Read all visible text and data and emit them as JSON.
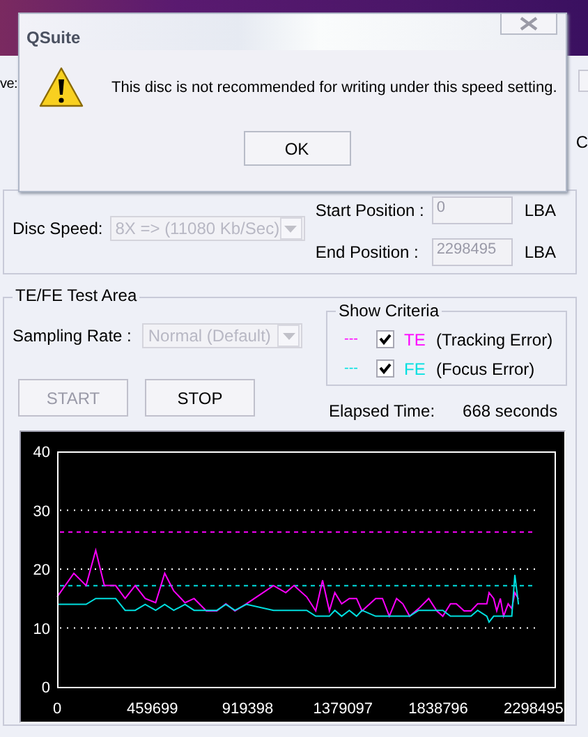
{
  "background_window": {
    "row_label_fragment": "ve:",
    "right_label_fragment": "C"
  },
  "dialog": {
    "title": "QSuite",
    "message": "This disc is not recommended for writing under this speed setting.",
    "buttons": [
      "OK"
    ]
  },
  "settings": {
    "disc_speed": {
      "label": "Disc Speed:",
      "value": "8X => (11080 Kb/Sec)",
      "disabled": true
    },
    "positions": [
      {
        "label": "Start Position :",
        "value": "0",
        "unit": "LBA",
        "disabled": true
      },
      {
        "label": "End Position  :",
        "value": "2298495",
        "unit": "LBA",
        "disabled": true
      }
    ]
  },
  "test_area": {
    "title": "TE/FE Test Area",
    "sampling_rate": {
      "label": "Sampling Rate :",
      "value": "Normal (Default)",
      "disabled": true
    },
    "show_criteria": {
      "title": "Show Criteria",
      "items": [
        {
          "marker": "---",
          "label": "(Tracking Error)",
          "checked": true,
          "color": "#ff00ff"
        },
        {
          "marker": "---",
          "label": "(Focus Error)",
          "checked": true,
          "color": "#00e0e0"
        }
      ]
    },
    "buttons": [
      {
        "label": "START",
        "disabled": true
      },
      {
        "label": "STOP",
        "disabled": false
      }
    ],
    "elapsed": {
      "label": "Elapsed Time:",
      "value": "668 seconds"
    },
    "chart_data": {
      "type": "line",
      "xlim": [
        0,
        2400000
      ],
      "ylim": [
        0,
        40
      ],
      "xticks": [
        0,
        459699,
        919398,
        1379097,
        1838796,
        2298495
      ],
      "yticks": [
        0,
        10,
        20,
        30,
        40
      ],
      "x": [
        0,
        81000,
        140100,
        186100,
        227700,
        282400,
        328400,
        376500,
        424700,
        475000,
        518800,
        562600,
        617300,
        661100,
        720200,
        770500,
        814300,
        858100,
        912800,
        1044200,
        1103300,
        1142700,
        1204000,
        1247800,
        1280600,
        1313400,
        1339700,
        1372600,
        1409700,
        1444800,
        1471000,
        1536700,
        1569500,
        1602400,
        1637400,
        1668000,
        1700900,
        1744700,
        1792800,
        1832200,
        1860700,
        1897900,
        1926300,
        1963600,
        1996400,
        2029200,
        2073000,
        2084000,
        2105900,
        2121200,
        2138700,
        2154000,
        2175900,
        2193400,
        2208700,
        2226200
      ],
      "series": [
        {
          "name": "TE",
          "color": "#ff00ff",
          "values": [
            15.3,
            19.3,
            17.2,
            23.2,
            17.2,
            17.2,
            15.0,
            17.2,
            15.0,
            14.3,
            19.3,
            16.3,
            14.3,
            15.0,
            12.9,
            12.9,
            14.1,
            12.9,
            14.1,
            17.2,
            16.0,
            17.2,
            15.3,
            12.9,
            18.1,
            12.9,
            16.0,
            14.1,
            15.0,
            15.0,
            12.9,
            15.0,
            15.0,
            12.0,
            15.0,
            14.1,
            12.0,
            13.3,
            15.0,
            12.9,
            12.0,
            14.1,
            14.1,
            12.9,
            12.9,
            14.1,
            14.1,
            16.0,
            15.0,
            12.9,
            15.0,
            12.0,
            14.1,
            13.3,
            16.0,
            14.9
          ]
        },
        {
          "name": "FE",
          "color": "#00e0e0",
          "values": [
            14,
            14,
            14,
            15,
            15,
            15,
            13,
            13,
            14,
            13,
            14,
            13,
            14,
            13,
            13,
            13,
            14,
            13,
            14,
            13,
            13,
            13,
            13,
            12,
            12,
            12,
            13,
            12,
            13,
            12,
            13,
            12,
            12,
            12,
            12,
            12,
            12,
            13,
            13,
            13,
            13,
            12,
            12,
            12,
            12,
            13,
            12,
            11,
            12,
            12,
            12,
            12,
            12,
            12,
            19,
            14
          ]
        }
      ],
      "grid": true,
      "ref_lines": [
        {
          "axis": "y",
          "value": 26.3,
          "color": "#ff00ff"
        },
        {
          "axis": "y",
          "value": 17.2,
          "color": "#00e0e0"
        }
      ]
    }
  }
}
